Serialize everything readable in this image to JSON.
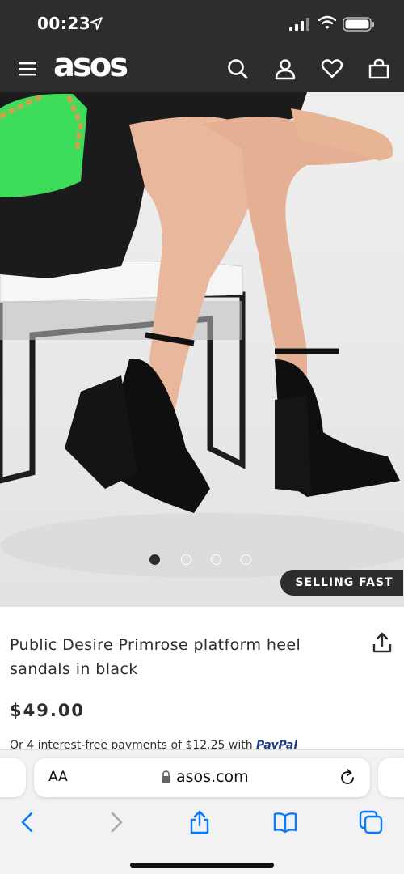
{
  "status": {
    "time": "00:23"
  },
  "header": {
    "logo": "asos",
    "icons": [
      "menu-icon",
      "search-icon",
      "account-icon",
      "heart-icon",
      "bag-icon"
    ]
  },
  "gallery": {
    "image_count": 4,
    "active_index": 0,
    "badge": "SELLING FAST"
  },
  "product": {
    "title_line1": "Public Desire Primrose platform heel",
    "title_line2": "sandals in black",
    "price": "$49.00",
    "installment_text": "Or 4 interest-free payments of $12.25 with",
    "installment_brand": "PayPal"
  },
  "browser": {
    "text_size_label": "AA",
    "domain": "asos.com"
  },
  "colors": {
    "header_bg": "#2d2d2d",
    "badge_bg": "#2d2d2d",
    "ios_blue": "#0a7aff",
    "paypal_blue": "#1f3c88"
  }
}
